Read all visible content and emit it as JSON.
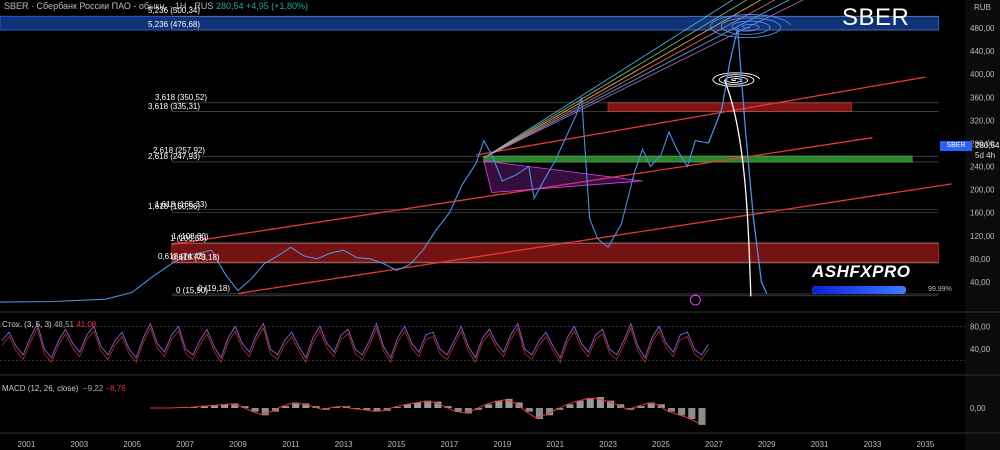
{
  "header": {
    "title": "SBER · Сбербанк России ПАО - обыкн. · 1Н · RUS",
    "price": "280,54",
    "change": "+4,95 (+1,80%)"
  },
  "brand": "SBER",
  "currency": "RUB",
  "watermark": {
    "logo": "ASHFXPRO",
    "progress_label": "99.99%",
    "progress_value": 0.9999
  },
  "price_tag": {
    "symbol": "SBER",
    "value": "280,54",
    "timeframe": "5d 4h"
  },
  "fib_labels": [
    {
      "text": "5,236 (500,34)",
      "y": 500.34
    },
    {
      "text": "5,236 (476,68)",
      "y": 476.68
    },
    {
      "text": "3,618 (350,52)",
      "y": 350.52
    },
    {
      "text": "3,618 (335,31)",
      "y": 335.31
    },
    {
      "text": "2,618 (257,92)",
      "y": 257.92
    },
    {
      "text": "2,618 (247,93)",
      "y": 247.93
    },
    {
      "text": "1,618 (165,33)",
      "y": 165.33
    },
    {
      "text": "1,618 (160,56)",
      "y": 160.56
    },
    {
      "text": "1 (108,80)",
      "y": 108.8
    },
    {
      "text": "1 (106,56)",
      "y": 106.56
    },
    {
      "text": "0,618 (74,43)",
      "y": 74.43
    },
    {
      "text": "0,618 (73,18)",
      "y": 73.18
    },
    {
      "text": "0 (15,90)",
      "y": 15.9
    },
    {
      "text": "0 (19,18)",
      "y": 19.18
    }
  ],
  "indicators": {
    "stoch_label": "Стох. (3, 5, 3)",
    "stoch_v1": "48,51",
    "stoch_v2": "41,08",
    "macd_label": "MACD (12, 26, close)",
    "macd_v1": "−9,22",
    "macd_v2": "−8,76"
  },
  "colors": {
    "price_line": "#4a90e2",
    "resistance_zone": "#b71c1c",
    "support_zone": "#2e9e2e",
    "target_zone": "#1e5bd8",
    "channel_line": "#e53935",
    "stoch_line": "#7e57c2"
  },
  "chart_data": {
    "type": "line",
    "title": "SBER",
    "xlabel": "",
    "ylabel": "RUB",
    "ylim": [
      0,
      520
    ],
    "log_scale": false,
    "grid": false,
    "x_ticks": [
      "2001",
      "2003",
      "2005",
      "2007",
      "2009",
      "2011",
      "2013",
      "2015",
      "2017",
      "2019",
      "2021",
      "2023",
      "2025",
      "2027",
      "2029",
      "2031",
      "2033",
      "2035"
    ],
    "y_ticks": [
      "40,00",
      "80,00",
      "120,00",
      "160,00",
      "200,00",
      "240,00",
      "280,00",
      "320,00",
      "360,00",
      "400,00",
      "440,00",
      "480,00"
    ],
    "series": [
      {
        "x": [
          2000.0,
          2002.0,
          2004.0,
          2005.0,
          2005.8,
          2006.5,
          2007.0,
          2007.5,
          2008.0,
          2008.5,
          2009.0,
          2009.5,
          2010.0,
          2010.5,
          2011.0,
          2011.5,
          2012.0,
          2012.5,
          2013.0,
          2013.5,
          2014.0,
          2014.5,
          2015.0,
          2015.5,
          2016.0,
          2016.5,
          2017.0,
          2017.5,
          2018.0,
          2018.3,
          2018.6,
          2019.0,
          2019.5,
          2020.0,
          2020.2,
          2020.5,
          2021.0,
          2021.5,
          2021.8,
          2022.0,
          2022.3,
          2022.6,
          2023.0,
          2023.5,
          2024.0,
          2024.3,
          2024.6,
          2025.0,
          2025.3,
          2025.6,
          2026.0,
          2026.3,
          2026.8
        ],
        "values": [
          5,
          6,
          10,
          22,
          50,
          72,
          85,
          90,
          95,
          55,
          25,
          45,
          72,
          85,
          100,
          85,
          80,
          90,
          95,
          82,
          80,
          72,
          60,
          70,
          95,
          130,
          160,
          210,
          245,
          285,
          260,
          215,
          225,
          240,
          185,
          210,
          250,
          300,
          330,
          360,
          150,
          115,
          100,
          140,
          230,
          270,
          240,
          260,
          300,
          270,
          240,
          285,
          280.54
        ]
      },
      {
        "x": [
          2026.8,
          2027.3,
          2027.6,
          2027.9,
          2028.2,
          2028.5,
          2028.8,
          2029.0
        ],
        "values": [
          280.54,
          340,
          420,
          480,
          300,
          150,
          40,
          20
        ]
      }
    ],
    "zones": [
      {
        "name": "target",
        "y": [
          476.68,
          500.34
        ],
        "x": [
          2000,
          2035.5
        ]
      },
      {
        "name": "resistance",
        "y": [
          335.31,
          350.52
        ],
        "x": [
          2023,
          2032.2
        ]
      },
      {
        "name": "support",
        "y": [
          247.93,
          257.92
        ],
        "x": [
          2018.3,
          2034.5
        ]
      },
      {
        "name": "base",
        "y": [
          73.18,
          106.56
        ],
        "x": [
          2006.5,
          2035.5
        ]
      }
    ]
  },
  "stoch_data": {
    "type": "line",
    "ylim": [
      0,
      100
    ],
    "y_ticks": [
      "40,00",
      "80,00"
    ],
    "values": [
      55,
      70,
      45,
      30,
      60,
      85,
      40,
      25,
      55,
      75,
      50,
      35,
      65,
      80,
      45,
      30,
      55,
      70,
      40,
      25,
      60,
      85,
      50,
      35,
      65,
      80,
      40,
      30,
      55,
      75,
      45,
      25,
      60,
      80,
      50,
      35,
      65,
      85,
      40,
      30,
      55,
      70,
      45,
      25,
      60,
      80,
      50,
      35,
      65,
      75,
      40,
      30,
      55,
      85,
      45,
      25,
      60,
      80,
      50,
      35,
      65,
      70,
      40,
      30,
      55,
      80,
      45,
      25,
      60,
      75,
      50,
      35,
      65,
      85,
      40,
      30,
      55,
      70,
      45,
      25,
      60,
      80,
      50,
      35,
      65,
      75,
      40,
      30,
      55,
      85,
      45,
      25,
      60,
      80,
      50,
      35,
      65,
      70,
      40,
      30,
      48.51
    ]
  },
  "macd_data": {
    "type": "bar",
    "ylim": [
      -12,
      12
    ],
    "y_ticks": [
      "0,00"
    ],
    "values": [
      0,
      0,
      0,
      0.3,
      0.5,
      1.0,
      1.5,
      2.0,
      2.5,
      1.0,
      -2.0,
      -4.0,
      -2.0,
      1.0,
      3.0,
      2.5,
      1.0,
      -1.0,
      0.5,
      1.0,
      -0.5,
      -1.0,
      -2.0,
      -1.5,
      0.5,
      2.0,
      3.0,
      4.0,
      3.5,
      1.0,
      -2.0,
      -3.0,
      -1.0,
      2.0,
      4.0,
      5.0,
      3.0,
      -2.0,
      -6.0,
      -4.0,
      -1.0,
      2.0,
      4.0,
      5.5,
      6.0,
      4.0,
      2.0,
      -1.0,
      1.0,
      3.0,
      2.0,
      -2.0,
      -4.0,
      -6.0,
      -9.22
    ]
  }
}
